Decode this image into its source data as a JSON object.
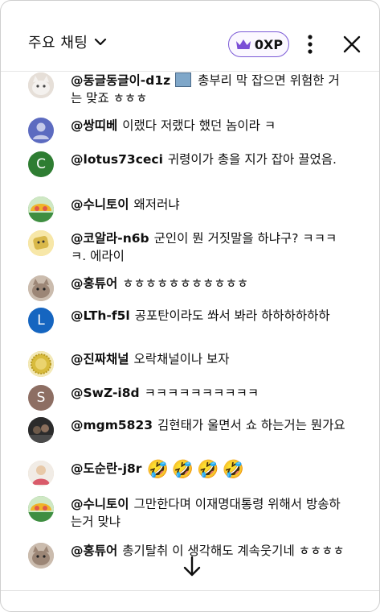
{
  "header": {
    "title": "주요 채팅",
    "xp_label": "0XP",
    "colors": {
      "xp_border": "#7b5ad6",
      "crown": "#7b4fd6"
    }
  },
  "messages": [
    {
      "author": "@동글동글이-d1z",
      "text": "총부리 막 잡으면 위험한 거는 맞죠 ㅎㅎㅎ",
      "avatar": {
        "kind": "cat-photo",
        "color": "#d9d2cc"
      },
      "has_sticker": true
    },
    {
      "author": "@쌍띠베",
      "text": "이랬다 저랬다 했던 놈이라 ㅋ",
      "avatar": {
        "kind": "person-icon",
        "color": "#5c6bc0"
      }
    },
    {
      "author": "@lotus73ceci",
      "text": "귀령이가 총을 지가 잡아 끌었음.",
      "avatar": {
        "kind": "letter",
        "letter": "C",
        "color": "#2e7d32"
      }
    },
    {
      "author": "@수니토이",
      "text": "왜저러냐",
      "avatar": {
        "kind": "toy-photo",
        "color": "#3e8e41"
      }
    },
    {
      "author": "@코알라-n6b",
      "text": "군인이 뭔 거짓말을 하냐구? ㅋㅋㅋㅋ. 에라이",
      "avatar": {
        "kind": "cartoon",
        "color": "#f2d36b"
      }
    },
    {
      "author": "@홍튜어",
      "text": "ㅎㅎㅎㅎㅎㅎㅎㅎㅎㅎㅎ",
      "avatar": {
        "kind": "cat-photo",
        "color": "#b9a89a"
      }
    },
    {
      "author": "@LTh-f5l",
      "text": "공포탄이라도 쏴서 봐라 하하하하하하",
      "avatar": {
        "kind": "letter",
        "letter": "L",
        "color": "#1565c0"
      }
    },
    {
      "author": "@진짜채널",
      "text": "오락채널이나 보자",
      "avatar": {
        "kind": "badge",
        "color": "#e0c64a"
      }
    },
    {
      "author": "@SwZ-i8d",
      "text": "ㅋㅋㅋㅋㅋㅋㅋㅋㅋㅋ",
      "avatar": {
        "kind": "letter",
        "letter": "S",
        "color": "#8d6e63"
      }
    },
    {
      "author": "@mgm5823",
      "text": "김현태가 울면서 쇼 하는거는 뭔가요",
      "avatar": {
        "kind": "dark-photo",
        "color": "#3a3a3a"
      }
    },
    {
      "author": "@도순란-j8r",
      "text": "",
      "emojis": [
        "🤣",
        "🤣",
        "🤣",
        "🤣"
      ],
      "avatar": {
        "kind": "photo",
        "color": "#e8c9a8"
      }
    },
    {
      "author": "@수니토이",
      "text": "그만한다며 이재명대통령 위해서 방송하는거 맞냐",
      "avatar": {
        "kind": "toy-photo",
        "color": "#3e8e41"
      }
    },
    {
      "author": "@홍튜어",
      "text": "총기탈취 이 생각해도 계속웃기네 ㅎㅎㅎㅎ",
      "avatar": {
        "kind": "cat-photo",
        "color": "#b9a89a"
      }
    }
  ]
}
